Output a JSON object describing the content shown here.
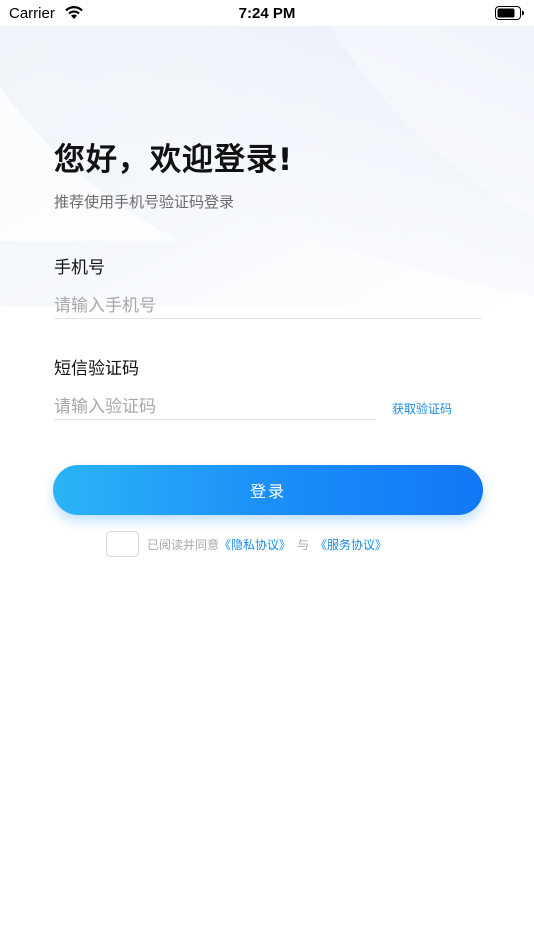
{
  "status_bar": {
    "carrier": "Carrier",
    "time": "7:24 PM",
    "icons": [
      "wifi-icon",
      "battery-icon"
    ]
  },
  "login": {
    "title": "您好，欢迎登录!",
    "subtitle": "推荐使用手机号验证码登录",
    "phone_label": "手机号",
    "phone_placeholder": "请输入手机号",
    "phone_value": "",
    "code_label": "短信验证码",
    "code_placeholder": "请输入验证码",
    "code_value": "",
    "get_code_label": "获取验证码",
    "login_button_label": "登录"
  },
  "agreement": {
    "checked": false,
    "prefix": "已阅读并同意",
    "privacy_link": "《隐私协议》",
    "connector": "与",
    "service_link": "《服务协议》"
  },
  "colors": {
    "accent": "#1a8ae0",
    "button_start": "#2ab4f7",
    "button_end": "#1277f6",
    "background_tint": "#eef4fb"
  }
}
